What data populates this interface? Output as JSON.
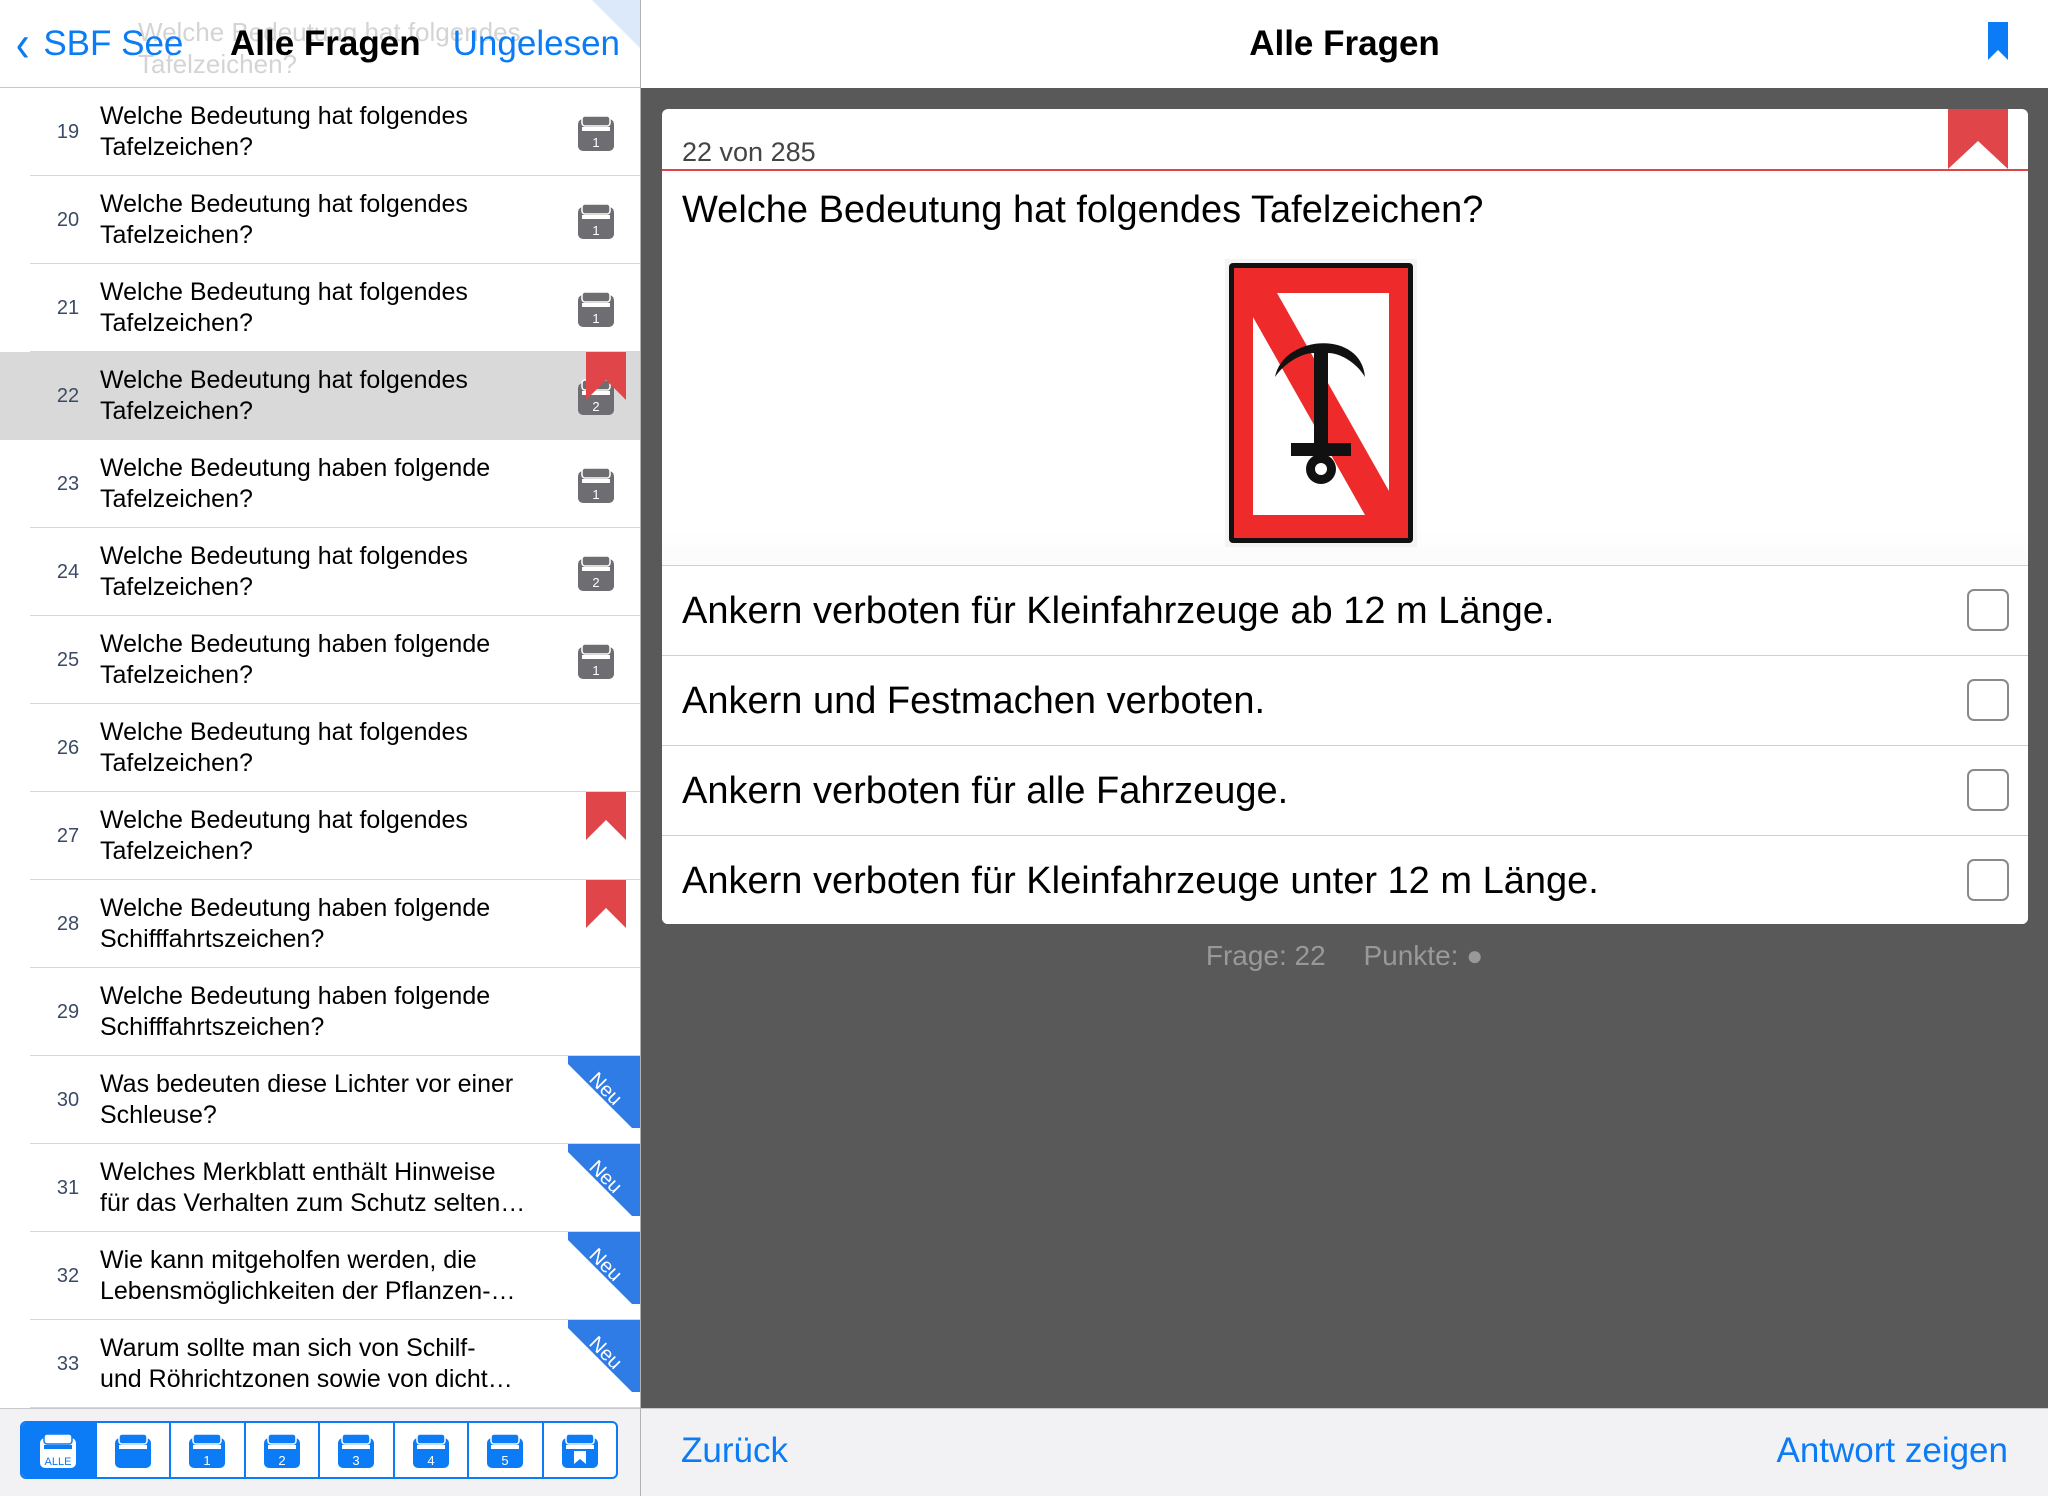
{
  "left_nav": {
    "back_label": "SBF See",
    "title": "Alle Fragen",
    "unread_label": "Ungelesen",
    "ghost_text": "Welche Bedeutung hat folgendes Tafelzeichen?"
  },
  "questions": [
    {
      "num": "19",
      "text": "Welche Bedeutung hat folgendes\nTafelzeichen?",
      "box": "1",
      "bookmarked": false,
      "new": false
    },
    {
      "num": "20",
      "text": "Welche Bedeutung hat folgendes\nTafelzeichen?",
      "box": "1",
      "bookmarked": false,
      "new": false
    },
    {
      "num": "21",
      "text": "Welche Bedeutung hat folgendes\nTafelzeichen?",
      "box": "1",
      "bookmarked": false,
      "new": false
    },
    {
      "num": "22",
      "text": "Welche Bedeutung hat folgendes\nTafelzeichen?",
      "box": "2",
      "bookmarked": true,
      "new": false,
      "selected": true
    },
    {
      "num": "23",
      "text": "Welche Bedeutung haben folgende\nTafelzeichen?",
      "box": "1",
      "bookmarked": false,
      "new": false
    },
    {
      "num": "24",
      "text": "Welche Bedeutung hat folgendes\nTafelzeichen?",
      "box": "2",
      "bookmarked": false,
      "new": false
    },
    {
      "num": "25",
      "text": "Welche Bedeutung haben folgende\nTafelzeichen?",
      "box": "1",
      "bookmarked": false,
      "new": false
    },
    {
      "num": "26",
      "text": "Welche Bedeutung hat folgendes\nTafelzeichen?",
      "box": "",
      "bookmarked": false,
      "new": false
    },
    {
      "num": "27",
      "text": "Welche Bedeutung hat folgendes\nTafelzeichen?",
      "box": "",
      "bookmarked": true,
      "new": false
    },
    {
      "num": "28",
      "text": "Welche Bedeutung haben folgende\nSchifffahrtszeichen?",
      "box": "",
      "bookmarked": true,
      "new": false
    },
    {
      "num": "29",
      "text": "Welche Bedeutung haben folgende\nSchifffahrtszeichen?",
      "box": "",
      "bookmarked": false,
      "new": false
    },
    {
      "num": "30",
      "text": "Was bedeuten diese Lichter vor einer\nSchleuse?",
      "box": "",
      "bookmarked": false,
      "new": true
    },
    {
      "num": "31",
      "text": "Welches Merkblatt enthält Hinweise\nfür das Verhalten zum Schutz selten…",
      "box": "",
      "bookmarked": false,
      "new": true
    },
    {
      "num": "32",
      "text": "Wie kann mitgeholfen werden, die\nLebensmöglichkeiten der Pflanzen-…",
      "box": "",
      "bookmarked": false,
      "new": true
    },
    {
      "num": "33",
      "text": "Warum sollte man sich von Schilf-\nund Röhrichtzonen sowie von dicht…",
      "box": "",
      "bookmarked": false,
      "new": true
    }
  ],
  "new_badge_label": "Neu",
  "tab_bar": {
    "tabs": [
      {
        "label": "ALLE",
        "icon": "all-boxes-icon",
        "active": true
      },
      {
        "label": "",
        "icon": "box-icon",
        "active": false
      },
      {
        "label": "1",
        "icon": "box-icon",
        "active": false
      },
      {
        "label": "2",
        "icon": "box-icon",
        "active": false
      },
      {
        "label": "3",
        "icon": "box-icon",
        "active": false
      },
      {
        "label": "4",
        "icon": "box-icon",
        "active": false
      },
      {
        "label": "5",
        "icon": "box-icon",
        "active": false
      },
      {
        "label": "",
        "icon": "bookmark-box-icon",
        "active": false
      }
    ]
  },
  "right_nav": {
    "title": "Alle Fragen"
  },
  "card": {
    "counter": "22 von 285",
    "question": "Welche Bedeutung hat folgendes Tafelzeichen?",
    "sign_icon": "no-anchoring-sign-icon",
    "answers": [
      "Ankern verboten für Kleinfahrzeuge ab 12 m Länge.",
      "Ankern und Festmachen verboten.",
      "Ankern verboten für alle Fahrzeuge.",
      "Ankern verboten für Kleinfahrzeuge unter 12 m Länge."
    ]
  },
  "status": {
    "question_label": "Frage: 22",
    "points_label": "Punkte: ●"
  },
  "bottom_bar": {
    "prev_label": "Zurück",
    "show_answer_label": "Antwort zeigen"
  },
  "colors": {
    "accent": "#0b7cf5",
    "bookmark_red": "#e0454a",
    "new_badge_blue": "#2f7ce6",
    "right_background": "#595959",
    "selected_row": "#d9d9d9"
  }
}
